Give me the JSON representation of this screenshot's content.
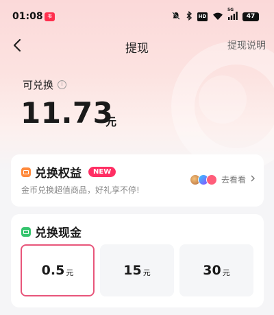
{
  "status": {
    "time": "01:08",
    "app_badge": "小红书",
    "hd": "HD",
    "net": "5G",
    "battery": "47"
  },
  "nav": {
    "title": "提现",
    "right_link": "提现说明"
  },
  "balance": {
    "label": "可兑换",
    "amount": "11.73",
    "unit": "元"
  },
  "benefits": {
    "title": "兑换权益",
    "badge": "NEW",
    "subtitle": "金币兑换超值商品，好礼享不停!",
    "go_label": "去看看"
  },
  "cash": {
    "title": "兑换现金",
    "options": [
      {
        "value": "0.5",
        "unit": "元",
        "selected": true
      },
      {
        "value": "15",
        "unit": "元",
        "selected": false
      },
      {
        "value": "30",
        "unit": "元",
        "selected": false
      }
    ]
  },
  "colors": {
    "accent": "#e8557a",
    "badge": "#ff2e63",
    "gift_icon": "#ff8a3d",
    "cash_icon": "#36c46e"
  }
}
